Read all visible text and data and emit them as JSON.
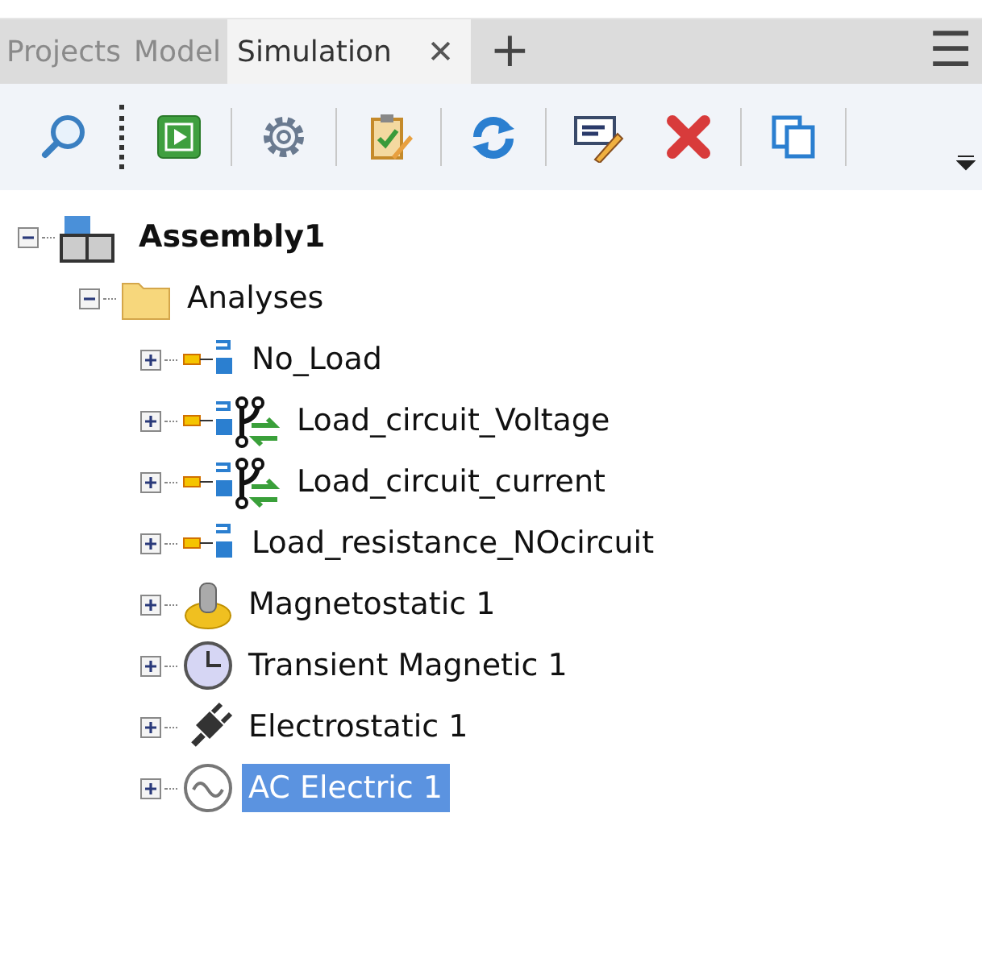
{
  "tabs": [
    {
      "label": "Projects",
      "selected": false
    },
    {
      "label": "Model",
      "selected": false
    },
    {
      "label": "Simulation",
      "selected": true,
      "close": "✕"
    }
  ],
  "add_tab": "+",
  "menu": "☰",
  "toolbar": [
    {
      "kind": "search"
    },
    {
      "kind": "grip"
    },
    {
      "kind": "run"
    },
    {
      "kind": "separator"
    },
    {
      "kind": "gear"
    },
    {
      "kind": "separator"
    },
    {
      "kind": "clipboard"
    },
    {
      "kind": "separator"
    },
    {
      "kind": "refresh"
    },
    {
      "kind": "separator"
    },
    {
      "kind": "rename"
    },
    {
      "kind": "delete"
    },
    {
      "kind": "separator"
    },
    {
      "kind": "copy"
    },
    {
      "kind": "separator"
    }
  ],
  "tree": [
    {
      "label": "Assembly1",
      "kind": "assembly",
      "expanded": true,
      "selected": false,
      "children": [
        {
          "label": "Analyses",
          "kind": "folder",
          "expanded": true,
          "selected": false,
          "children": [
            {
              "label": "No_Load",
              "kind": "static",
              "expanded": false,
              "selected": false
            },
            {
              "label": "Load_circuit_Voltage",
              "kind": "circuit",
              "expanded": false,
              "selected": false
            },
            {
              "label": "Load_circuit_current",
              "kind": "circuit",
              "expanded": false,
              "selected": false
            },
            {
              "label": "Load_resistance_NOcircuit",
              "kind": "static",
              "expanded": false,
              "selected": false
            },
            {
              "label": "Magnetostatic 1",
              "kind": "magnet",
              "expanded": false,
              "selected": false
            },
            {
              "label": "Transient Magnetic 1",
              "kind": "clock",
              "expanded": false,
              "selected": false
            },
            {
              "label": "Electrostatic 1",
              "kind": "plug",
              "expanded": false,
              "selected": false
            },
            {
              "label": "AC Electric 1",
              "kind": "ac",
              "expanded": false,
              "selected": true
            }
          ]
        }
      ]
    }
  ]
}
